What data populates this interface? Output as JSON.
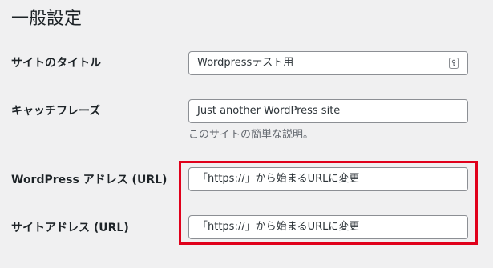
{
  "page": {
    "title": "一般設定"
  },
  "fields": {
    "site_title": {
      "label": "サイトのタイトル",
      "value": "Wordpressテスト用",
      "icon": "autofill-key-icon"
    },
    "tagline": {
      "label": "キャッチフレーズ",
      "value": "Just another WordPress site",
      "description": "このサイトの簡単な説明。"
    },
    "wordpress_address": {
      "label": "WordPress アドレス (URL)",
      "value": "「https://」から始まるURLに変更"
    },
    "site_address": {
      "label": "サイトアドレス (URL)",
      "value": "「https://」から始まるURLに変更"
    }
  },
  "annotation": {
    "highlight_color": "#e0001b"
  }
}
